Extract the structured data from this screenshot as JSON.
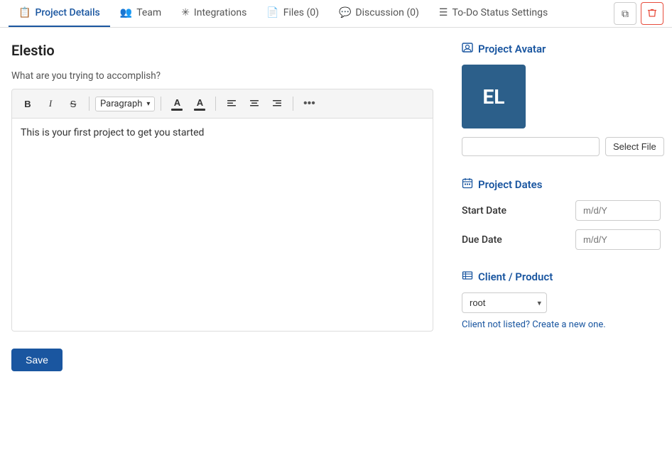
{
  "tabs": [
    {
      "id": "project-details",
      "label": "Project Details",
      "icon": "📋",
      "active": true,
      "count": null
    },
    {
      "id": "team",
      "label": "Team",
      "icon": "👥",
      "active": false,
      "count": null
    },
    {
      "id": "integrations",
      "label": "Integrations",
      "icon": "✳",
      "active": false,
      "count": null
    },
    {
      "id": "files",
      "label": "Files (0)",
      "icon": "📄",
      "active": false,
      "count": 0
    },
    {
      "id": "discussion",
      "label": "Discussion (0)",
      "icon": "💬",
      "active": false,
      "count": 0
    },
    {
      "id": "todo-status",
      "label": "To-Do Status Settings",
      "icon": "☰",
      "active": false,
      "count": null
    }
  ],
  "project": {
    "title": "Elestio"
  },
  "editor": {
    "prompt": "What are you trying to accomplish?",
    "paragraph_label": "Paragraph",
    "body_text": "This is your first project to get you started",
    "bold": "B",
    "italic": "I",
    "strikethrough": "S",
    "font_color": "A",
    "more": "•••"
  },
  "toolbar": {
    "save_label": "Save"
  },
  "right_panel": {
    "avatar_section_title": "Project Avatar",
    "avatar_initials": "EL",
    "select_file_label": "Select File",
    "dates_section_title": "Project Dates",
    "start_date_label": "Start Date",
    "start_date_placeholder": "m/d/Y",
    "due_date_label": "Due Date",
    "due_date_placeholder": "m/d/Y",
    "client_section_title": "Client / Product",
    "client_options": [
      "root"
    ],
    "client_selected": "root",
    "client_link_text": "Client not listed? Create a new one."
  },
  "icons": {
    "copy": "⎘",
    "delete": "🗑"
  }
}
